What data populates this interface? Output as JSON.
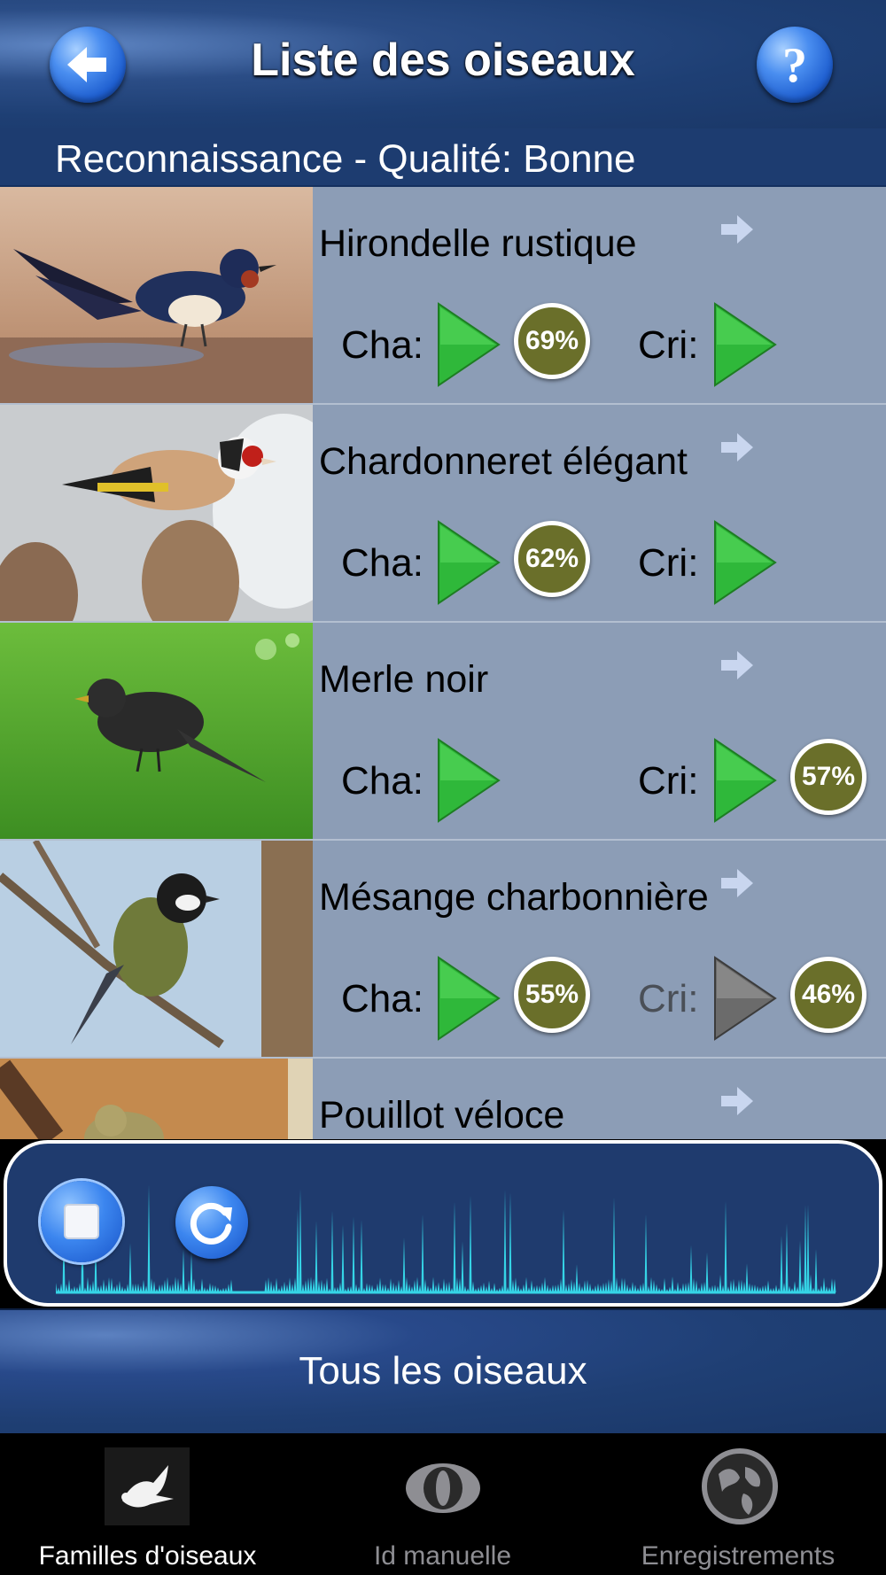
{
  "header": {
    "title": "Liste des oiseaux",
    "back_icon": "arrow-left-icon",
    "help_icon": "question-icon"
  },
  "subheader": {
    "text": "Reconnaissance - Qualité: Bonne"
  },
  "labels": {
    "song": "Cha:",
    "call": "Cri:"
  },
  "birds": [
    {
      "name": "Hirondelle rustique",
      "song_pct": "69%",
      "call_pct": "",
      "call_enabled": true
    },
    {
      "name": "Chardonneret élégant",
      "song_pct": "62%",
      "call_pct": "",
      "call_enabled": true
    },
    {
      "name": "Merle noir",
      "song_pct": "",
      "call_pct": "57%",
      "call_enabled": true
    },
    {
      "name": "Mésange charbonnière",
      "song_pct": "55%",
      "call_pct": "46%",
      "call_enabled": false
    },
    {
      "name": "Pouillot véloce",
      "song_pct": "",
      "call_pct": "",
      "call_enabled": true
    }
  ],
  "player": {
    "stop_icon": "stop-icon",
    "repeat_icon": "repeat-icon",
    "waveform_color": "#35d4e6"
  },
  "bottom_button": {
    "label": "Tous les oiseaux"
  },
  "tabbar": {
    "tabs": [
      {
        "label": "Familles d'oiseaux",
        "icon": "bird-icon",
        "active": true
      },
      {
        "label": "Id manuelle",
        "icon": "eye-icon",
        "active": false
      },
      {
        "label": "Enregistrements",
        "icon": "globe-icon",
        "active": false
      }
    ]
  },
  "colors": {
    "accent": "#1f3f74",
    "row_bg": "#8c9db6",
    "percent_badge": "#6a6f2a",
    "play_green": "#2fb83a"
  }
}
